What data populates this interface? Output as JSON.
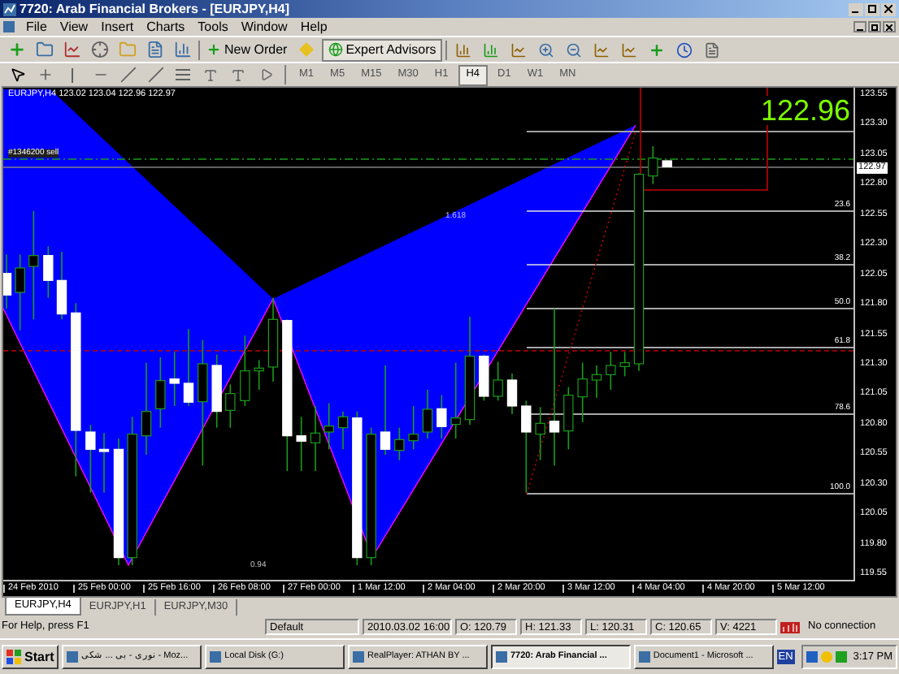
{
  "window": {
    "title": "7720: Arab Financial Brokers - [EURJPY,H4]"
  },
  "menu": [
    "File",
    "View",
    "Insert",
    "Charts",
    "Tools",
    "Window",
    "Help"
  ],
  "toolbar": {
    "new_order": "New Order",
    "expert_advisors": "Expert Advisors"
  },
  "timeframes": [
    {
      "label": "M1",
      "selected": false
    },
    {
      "label": "M5",
      "selected": false
    },
    {
      "label": "M15",
      "selected": false
    },
    {
      "label": "M30",
      "selected": false
    },
    {
      "label": "H1",
      "selected": false
    },
    {
      "label": "H4",
      "selected": true
    },
    {
      "label": "D1",
      "selected": false
    },
    {
      "label": "W1",
      "selected": false
    },
    {
      "label": "MN",
      "selected": false
    }
  ],
  "chart": {
    "info": "EURJPY,H4 123.02 123.04 122.96 122.97",
    "order_label": "#1346200 sell",
    "big_price": "122.96",
    "pattern_labels": [
      "1.618",
      "0.94"
    ],
    "fib_levels": [
      "23.6",
      "38.2",
      "50.0",
      "61.8",
      "78.6",
      "100.0"
    ],
    "price_axis": [
      "123.55",
      "123.30",
      "123.05",
      "122.80",
      "122.55",
      "122.30",
      "122.05",
      "121.80",
      "121.55",
      "121.30",
      "121.05",
      "120.80",
      "120.55",
      "120.30",
      "120.05",
      "119.80",
      "119.55"
    ],
    "current_price": "122.97",
    "time_axis": [
      "24 Feb 2010",
      "25 Feb 00:00",
      "25 Feb 16:00",
      "26 Feb 08:00",
      "27 Feb 00:00",
      "1 Mar 12:00",
      "2 Mar 04:00",
      "2 Mar 20:00",
      "3 Mar 12:00",
      "4 Mar 04:00",
      "4 Mar 20:00",
      "5 Mar 12:00"
    ]
  },
  "chart_tabs": [
    {
      "label": "EURJPY,H4",
      "selected": true
    },
    {
      "label": "EURJPY,H1",
      "selected": false
    },
    {
      "label": "EURJPY,M30",
      "selected": false
    }
  ],
  "status_bar": {
    "help": "For Help, press F1",
    "profile": "Default",
    "time": "2010.03.02 16:00",
    "ohlcv": [
      "O: 120.79",
      "H: 121.33",
      "L: 120.31",
      "C: 120.65",
      "V: 4221"
    ],
    "connection": "No connection"
  },
  "taskbar": {
    "start": "Start",
    "tasks": [
      {
        "label": "نوری - بی ... شکی - Moz...",
        "selected": false
      },
      {
        "label": "Local Disk (G:)",
        "selected": false
      },
      {
        "label": "RealPlayer: ATHAN BY ...",
        "selected": false
      },
      {
        "label": "7720: Arab Financial ...",
        "selected": true
      },
      {
        "label": "Document1 - Microsoft ...",
        "selected": false
      }
    ],
    "language": "EN",
    "clock": "3:17 PM"
  }
}
